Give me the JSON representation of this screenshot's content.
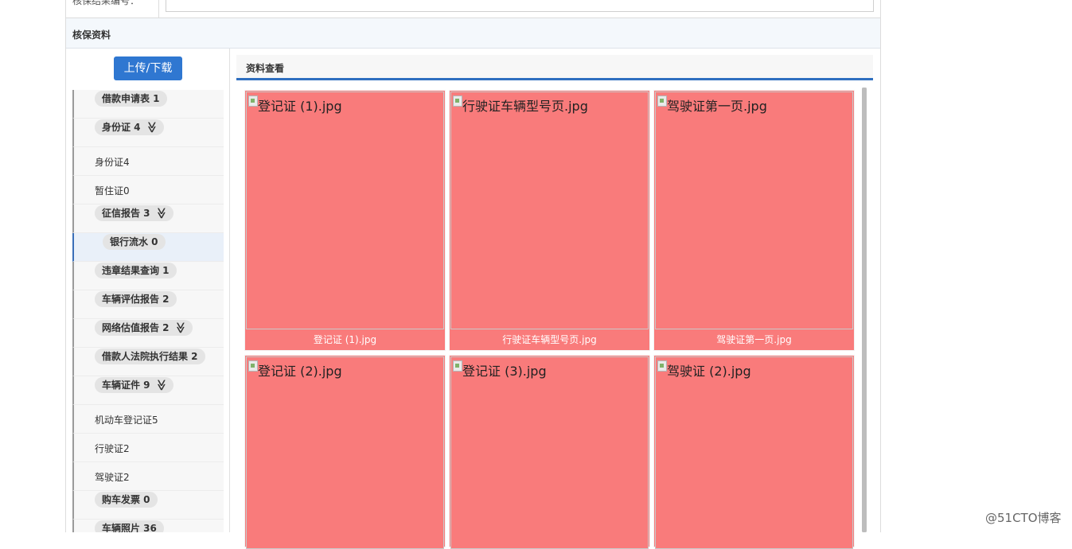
{
  "top_row": {
    "label": "核保结果编号："
  },
  "section": {
    "title": "核保资料"
  },
  "left": {
    "upload_button": "上传/下载",
    "items": [
      {
        "kind": "pill",
        "label": "借款申请表 1"
      },
      {
        "kind": "pill",
        "label": "身份证 4",
        "expand": true
      },
      {
        "kind": "plain",
        "label": "身份证4"
      },
      {
        "kind": "plain",
        "label": "暂住证0"
      },
      {
        "kind": "pill",
        "label": "征信报告 3",
        "expand": true
      },
      {
        "kind": "pill",
        "label": "银行流水 0",
        "active": true
      },
      {
        "kind": "pill",
        "label": "违章结果查询 1"
      },
      {
        "kind": "pill",
        "label": "车辆评估报告 2"
      },
      {
        "kind": "pill",
        "label": "网络估值报告 2",
        "expand": true
      },
      {
        "kind": "pill",
        "label": "借款人法院执行结果 2"
      },
      {
        "kind": "pill",
        "label": "车辆证件 9",
        "expand": true
      },
      {
        "kind": "plain",
        "label": "机动车登记证5"
      },
      {
        "kind": "plain",
        "label": "行驶证2"
      },
      {
        "kind": "plain",
        "label": "驾驶证2"
      },
      {
        "kind": "pill",
        "label": "购车发票 0"
      },
      {
        "kind": "pill",
        "label": "车辆照片 36"
      }
    ],
    "expand_glyph": "≫"
  },
  "viewer": {
    "title": "资料查看",
    "images": [
      {
        "alt": "登记证 (1).jpg",
        "caption": "登记证 (1).jpg"
      },
      {
        "alt": "行驶证车辆型号页.jpg",
        "caption": "行驶证车辆型号页.jpg"
      },
      {
        "alt": "驾驶证第一页.jpg",
        "caption": "驾驶证第一页.jpg"
      },
      {
        "alt": "登记证 (2).jpg",
        "caption": ""
      },
      {
        "alt": "登记证 (3).jpg",
        "caption": ""
      },
      {
        "alt": "驾驶证 (2).jpg",
        "caption": ""
      }
    ]
  },
  "watermark": "@51CTO博客",
  "colors": {
    "accent": "#2f77d1",
    "card": "#f97b7b",
    "tab_underline": "#2f6fc0"
  }
}
